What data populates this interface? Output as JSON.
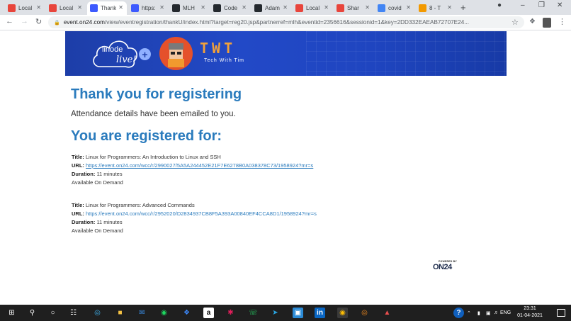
{
  "browser": {
    "tabs": [
      {
        "label": "Local",
        "icon": "local-tab-icon",
        "color": "#e8453c",
        "active": false
      },
      {
        "label": "Local",
        "icon": "local-tab-icon",
        "color": "#e8453c",
        "active": false
      },
      {
        "label": "Thank",
        "icon": "on24-tab-icon",
        "color": "#3d5afe",
        "active": true
      },
      {
        "label": "https:",
        "icon": "on24-tab-icon",
        "color": "#3d5afe",
        "active": false
      },
      {
        "label": "MLH",
        "icon": "github-icon",
        "color": "#24292e",
        "active": false
      },
      {
        "label": "Code",
        "icon": "github-icon",
        "color": "#24292e",
        "active": false
      },
      {
        "label": "Adam",
        "icon": "github-icon",
        "color": "#24292e",
        "active": false
      },
      {
        "label": "Local",
        "icon": "local-tab-icon",
        "color": "#e8453c",
        "active": false
      },
      {
        "label": "Shar",
        "icon": "local-tab-icon",
        "color": "#e8453c",
        "active": false
      },
      {
        "label": "covid",
        "icon": "google-icon",
        "color": "#4285f4",
        "active": false
      },
      {
        "label": "8 - T",
        "icon": "bookmark-tab-icon",
        "color": "#f29900",
        "active": false
      }
    ],
    "new_tab": "+",
    "url_host": "event.on24.com",
    "url_path": "/view/eventregistration/thankU/index.html?target=reg20.jsp&partnerref=mlh&eventid=2356616&sessionid=1&key=2DD332EAEAB72707E24..."
  },
  "banner": {
    "left_logo_text_1": "linode",
    "left_logo_text_2": "live!",
    "plus": "+",
    "right_logo_title": "TWT",
    "right_logo_sub": "Tech With Tim"
  },
  "content": {
    "heading_thanks": "Thank you for registering",
    "subtitle": "Attendance details have been emailed to you.",
    "heading_registered": "You are registered for:",
    "labels": {
      "title": "Title:",
      "url": "URL:",
      "duration": "Duration:"
    },
    "events": [
      {
        "title": "Linux for Programmers: An Introduction to Linux and SSH",
        "url": "https://event.on24.com/wcc/r/2990027/5A5A244452E21F7E6278B0A038378C73/1958924?mr=s",
        "duration": "11 minutes",
        "availability": "Available On Demand"
      },
      {
        "title": "Linux for Programmers: Advanced Commands",
        "url": "https://event.on24.com/wcc/r/2952020/D2834937CB8F5A393A00840EF4CCA8D1/1958924?mr=s",
        "duration": "11 minutes",
        "availability": "Available On Demand"
      }
    ],
    "powered_by": "POWERED BY",
    "on24": "ON24"
  },
  "taskbar": {
    "language": "ENG",
    "time": "23:31",
    "date": "01-04-2021"
  },
  "colors": {
    "heading": "#2a7bbd",
    "banner": "#1f45c0",
    "link": "#2a7bbd"
  }
}
